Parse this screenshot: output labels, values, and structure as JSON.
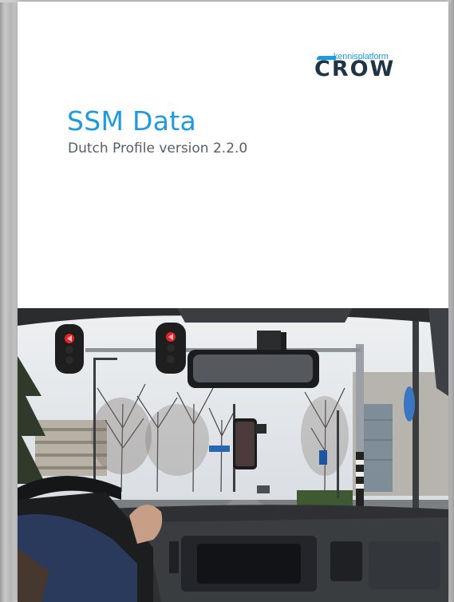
{
  "cover": {
    "title": "SSM Data",
    "subtitle": "Dutch Profile version 2.2.0",
    "logo": {
      "small_text": "kennisplatform",
      "big_text": "CROW",
      "color_accent": "#1d9be0",
      "color_dark": "#1f3445"
    },
    "photo": {
      "icon": "dashboard-view-traffic-lights-photo"
    }
  }
}
